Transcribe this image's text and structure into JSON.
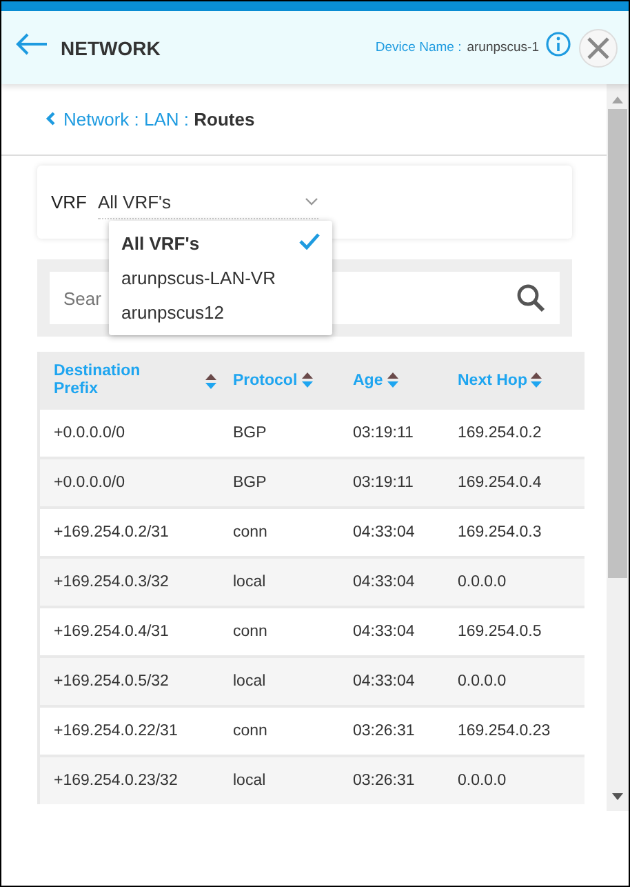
{
  "header": {
    "title": "NETWORK",
    "device_label": "Device Name :",
    "device_name": "arunpscus-1"
  },
  "breadcrumb": {
    "parts": [
      "Network : LAN : "
    ],
    "current": "Routes"
  },
  "vrf": {
    "label": "VRF",
    "value": "All VRF's",
    "expanded": true,
    "options": [
      {
        "label": "All VRF's",
        "selected": true
      },
      {
        "label": "arunpscus-LAN-VR",
        "selected": false
      },
      {
        "label": "arunpscus12",
        "selected": false
      }
    ]
  },
  "search": {
    "placeholder": "Sear"
  },
  "table": {
    "columns": [
      "Destination Prefix",
      "Protocol",
      "Age",
      "Next Hop"
    ],
    "rows": [
      [
        "+0.0.0.0/0",
        "BGP",
        "03:19:11",
        "169.254.0.2"
      ],
      [
        "+0.0.0.0/0",
        "BGP",
        "03:19:11",
        "169.254.0.4"
      ],
      [
        "+169.254.0.2/31",
        "conn",
        "04:33:04",
        "169.254.0.3"
      ],
      [
        "+169.254.0.3/32",
        "local",
        "04:33:04",
        "0.0.0.0"
      ],
      [
        "+169.254.0.4/31",
        "conn",
        "04:33:04",
        "169.254.0.5"
      ],
      [
        "+169.254.0.5/32",
        "local",
        "04:33:04",
        "0.0.0.0"
      ],
      [
        "+169.254.0.22/31",
        "conn",
        "03:26:31",
        "169.254.0.23"
      ],
      [
        "+169.254.0.23/32",
        "local",
        "03:26:31",
        "0.0.0.0"
      ]
    ]
  }
}
